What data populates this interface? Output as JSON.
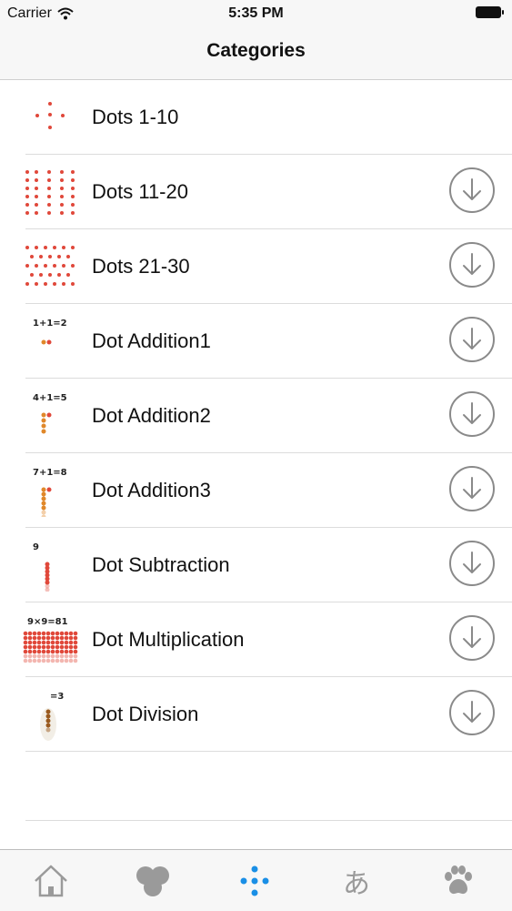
{
  "status_bar": {
    "carrier": "Carrier",
    "time": "5:35 PM"
  },
  "nav": {
    "title": "Categories"
  },
  "categories": [
    {
      "label": "Dots 1-10",
      "downloadable": false,
      "thumb_caption": ""
    },
    {
      "label": "Dots 11-20",
      "downloadable": true,
      "thumb_caption": ""
    },
    {
      "label": "Dots 21-30",
      "downloadable": true,
      "thumb_caption": ""
    },
    {
      "label": "Dot Addition1",
      "downloadable": true,
      "thumb_caption": "1+1=2"
    },
    {
      "label": "Dot Addition2",
      "downloadable": true,
      "thumb_caption": "4+1=5"
    },
    {
      "label": "Dot Addition3",
      "downloadable": true,
      "thumb_caption": "7+1=8"
    },
    {
      "label": "Dot Subtraction",
      "downloadable": true,
      "thumb_caption": "9"
    },
    {
      "label": "Dot Multiplication",
      "downloadable": true,
      "thumb_caption": "9×9=81"
    },
    {
      "label": "Dot Division",
      "downloadable": true,
      "thumb_caption": "=3"
    }
  ],
  "tabs": [
    {
      "icon": "home-icon",
      "active": false
    },
    {
      "icon": "clover-icon",
      "active": false
    },
    {
      "icon": "dots-icon",
      "active": true
    },
    {
      "icon": "hiragana-icon",
      "glyph": "あ",
      "active": false
    },
    {
      "icon": "paw-icon",
      "active": false
    }
  ],
  "colors": {
    "dot_red": "#e0483a",
    "dot_orange": "#e0882a",
    "dot_brown": "#9a5a1e",
    "tab_active": "#1a8fe6",
    "tab_inactive": "#9a9a9a",
    "download_ring": "#8a8a8a"
  }
}
